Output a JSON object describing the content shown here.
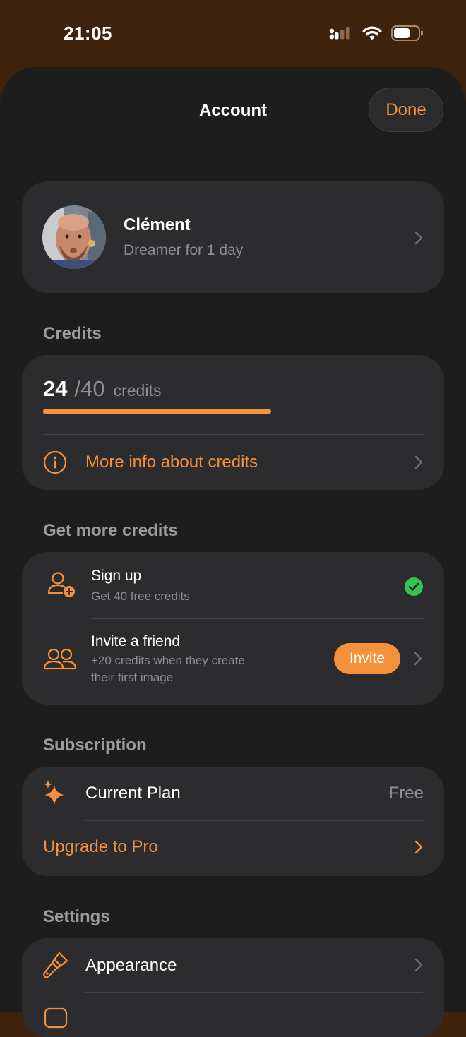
{
  "status": {
    "time": "21:05"
  },
  "header": {
    "title": "Account",
    "done_label": "Done"
  },
  "profile": {
    "name": "Clément",
    "subtitle": "Dreamer for 1 day"
  },
  "credits": {
    "section_title": "Credits",
    "current": "24",
    "total": "/40",
    "unit": "credits",
    "progress_fraction": 0.6,
    "info_label": "More info about credits"
  },
  "get_more": {
    "section_title": "Get more credits",
    "signup": {
      "title": "Sign up",
      "subtitle": "Get 40 free credits"
    },
    "invite": {
      "title": "Invite a friend",
      "subtitle_line1": "+20 credits when they create",
      "subtitle_line2": "their first image",
      "button_label": "Invite"
    }
  },
  "subscription": {
    "section_title": "Subscription",
    "current_plan_label": "Current Plan",
    "current_plan_value": "Free",
    "upgrade_label": "Upgrade to Pro"
  },
  "settings": {
    "section_title": "Settings",
    "appearance_label": "Appearance"
  },
  "colors": {
    "accent": "#f5913a",
    "success": "#30c553",
    "card": "#2c2c2e",
    "sheet": "#1d1d1e",
    "status_bg": "#3d230c"
  }
}
